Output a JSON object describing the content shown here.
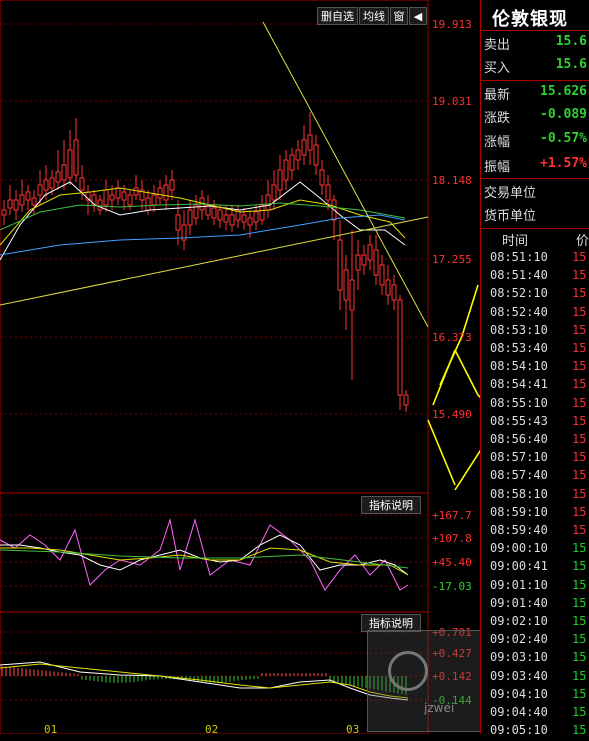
{
  "toolbar": {
    "buttons": [
      "删自选",
      "均线",
      "窗"
    ],
    "arrow": "◀"
  },
  "price_axis": [
    "19.913",
    "19.031",
    "18.148",
    "17.255",
    "16.373",
    "15.490"
  ],
  "oscillator_axis": [
    "+167.7",
    "+107.8",
    "+45.40",
    "-17.03"
  ],
  "macd_axis": [
    "+0.701",
    "+0.427",
    "+0.142",
    "-0.144"
  ],
  "indicator_label": "指标说明",
  "x_axis": [
    "01",
    "02",
    "03"
  ],
  "quote": {
    "name": "伦敦银现",
    "sell_label": "卖出",
    "sell_value": "15.6",
    "buy_label": "买入",
    "buy_value": "15.6",
    "latest_label": "最新",
    "latest_value": "15.626",
    "change_label": "涨跌",
    "change_value": "-0.089",
    "change_pct_label": "涨幅",
    "change_pct_value": "-0.57%",
    "amplitude_label": "振幅",
    "amplitude_value": "+1.57%",
    "trade_unit_label": "交易单位",
    "currency_unit_label": "货币单位"
  },
  "ticks": {
    "time_header": "时间",
    "price_header": "价",
    "rows": [
      {
        "t": "08:51:10",
        "p": "15.",
        "c": "red"
      },
      {
        "t": "08:51:40",
        "p": "15.",
        "c": "red"
      },
      {
        "t": "08:52:10",
        "p": "15.",
        "c": "red"
      },
      {
        "t": "08:52:40",
        "p": "15.",
        "c": "red"
      },
      {
        "t": "08:53:10",
        "p": "15.",
        "c": "red"
      },
      {
        "t": "08:53:40",
        "p": "15.",
        "c": "red"
      },
      {
        "t": "08:54:10",
        "p": "15.",
        "c": "red"
      },
      {
        "t": "08:54:41",
        "p": "15.",
        "c": "red"
      },
      {
        "t": "08:55:10",
        "p": "15.",
        "c": "red"
      },
      {
        "t": "08:55:43",
        "p": "15.",
        "c": "red"
      },
      {
        "t": "08:56:40",
        "p": "15.",
        "c": "red"
      },
      {
        "t": "08:57:10",
        "p": "15.",
        "c": "red"
      },
      {
        "t": "08:57:40",
        "p": "15.",
        "c": "red"
      },
      {
        "t": "08:58:10",
        "p": "15.",
        "c": "red"
      },
      {
        "t": "08:59:10",
        "p": "15.",
        "c": "red"
      },
      {
        "t": "08:59:40",
        "p": "15.",
        "c": "red"
      },
      {
        "t": "09:00:10",
        "p": "15.",
        "c": "green"
      },
      {
        "t": "09:00:41",
        "p": "15.",
        "c": "green"
      },
      {
        "t": "09:01:10",
        "p": "15.",
        "c": "green"
      },
      {
        "t": "09:01:40",
        "p": "15.",
        "c": "green"
      },
      {
        "t": "09:02:10",
        "p": "15.",
        "c": "green"
      },
      {
        "t": "09:02:40",
        "p": "15.",
        "c": "green"
      },
      {
        "t": "09:03:10",
        "p": "15.",
        "c": "green"
      },
      {
        "t": "09:03:40",
        "p": "15.",
        "c": "green"
      },
      {
        "t": "09:04:10",
        "p": "15.",
        "c": "green"
      },
      {
        "t": "09:04:40",
        "p": "15.",
        "c": "green"
      },
      {
        "t": "09:05:10",
        "p": "15.",
        "c": "green"
      }
    ]
  },
  "watermark": {
    "site": "jzwei"
  },
  "colors": {
    "up": "#ff3232",
    "down": "#00ffff",
    "grid": "#8b0000",
    "axis_red": "#ff3030",
    "axis_green": "#30d030",
    "annotation": "#ffff00"
  }
}
